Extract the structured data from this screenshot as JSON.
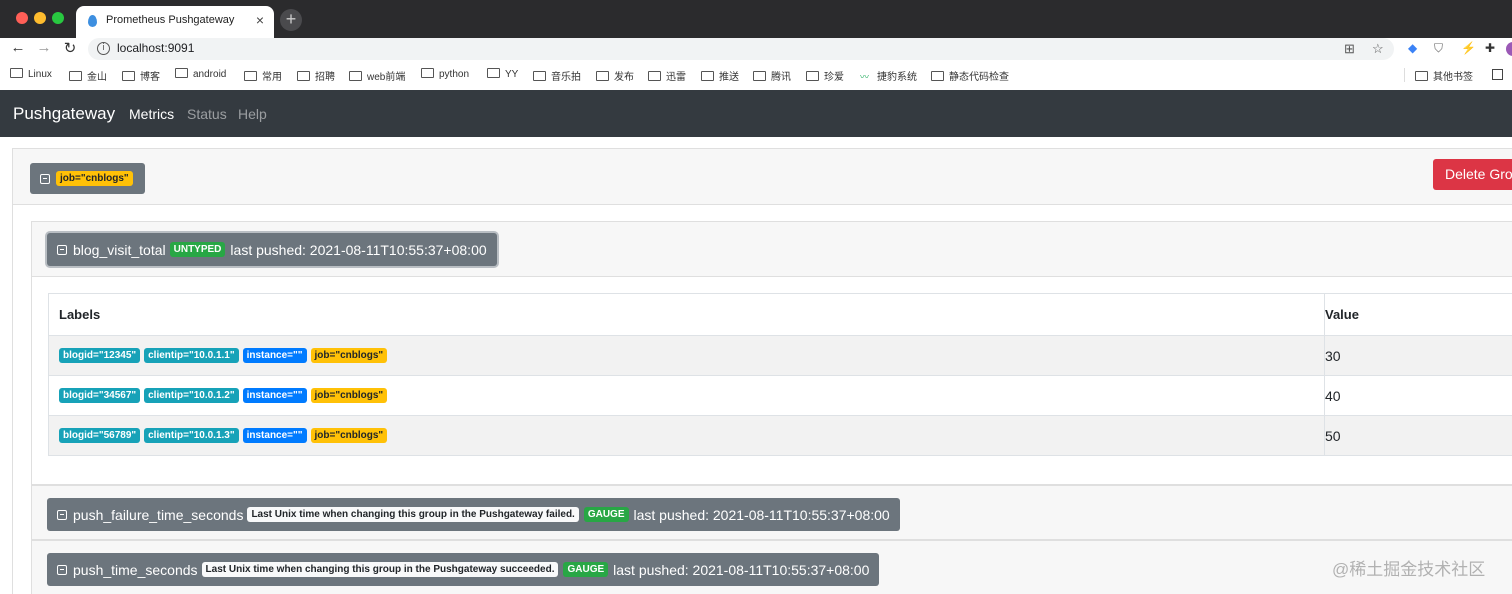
{
  "browser": {
    "tab_title": "Prometheus Pushgateway",
    "url": "localhost:9091",
    "bookmarks": [
      "Linux",
      "金山",
      "博客",
      "android",
      "常用",
      "招聘",
      "web前端",
      "python",
      "YY",
      "音乐拍",
      "发布",
      "迅雷",
      "推送",
      "腾讯",
      "珍爱",
      "捷豹系统",
      "静态代码检查"
    ],
    "other_bookmarks": "其他书签"
  },
  "navbar": {
    "brand": "Pushgateway",
    "links": [
      "Metrics",
      "Status",
      "Help"
    ]
  },
  "group": {
    "label": "job=\"cnblogs\"",
    "delete_label": "Delete Grou"
  },
  "metrics": [
    {
      "name": "blog_visit_total",
      "type": "UNTYPED",
      "last_pushed": "last pushed: 2021-08-11T10:55:37+08:00",
      "table": {
        "headers": [
          "Labels",
          "Value"
        ],
        "rows": [
          {
            "labels": [
              "blogid=\"12345\"",
              "clientip=\"10.0.1.1\"",
              "instance=\"\"",
              "job=\"cnblogs\""
            ],
            "value": "30"
          },
          {
            "labels": [
              "blogid=\"34567\"",
              "clientip=\"10.0.1.2\"",
              "instance=\"\"",
              "job=\"cnblogs\""
            ],
            "value": "40"
          },
          {
            "labels": [
              "blogid=\"56789\"",
              "clientip=\"10.0.1.3\"",
              "instance=\"\"",
              "job=\"cnblogs\""
            ],
            "value": "50"
          }
        ]
      }
    },
    {
      "name": "push_failure_time_seconds",
      "help": "Last Unix time when changing this group in the Pushgateway failed.",
      "type": "GAUGE",
      "last_pushed": "last pushed: 2021-08-11T10:55:37+08:00"
    },
    {
      "name": "push_time_seconds",
      "help": "Last Unix time when changing this group in the Pushgateway succeeded.",
      "type": "GAUGE",
      "last_pushed": "last pushed: 2021-08-11T10:55:37+08:00"
    }
  ],
  "watermark": "@稀土掘金技术社区"
}
